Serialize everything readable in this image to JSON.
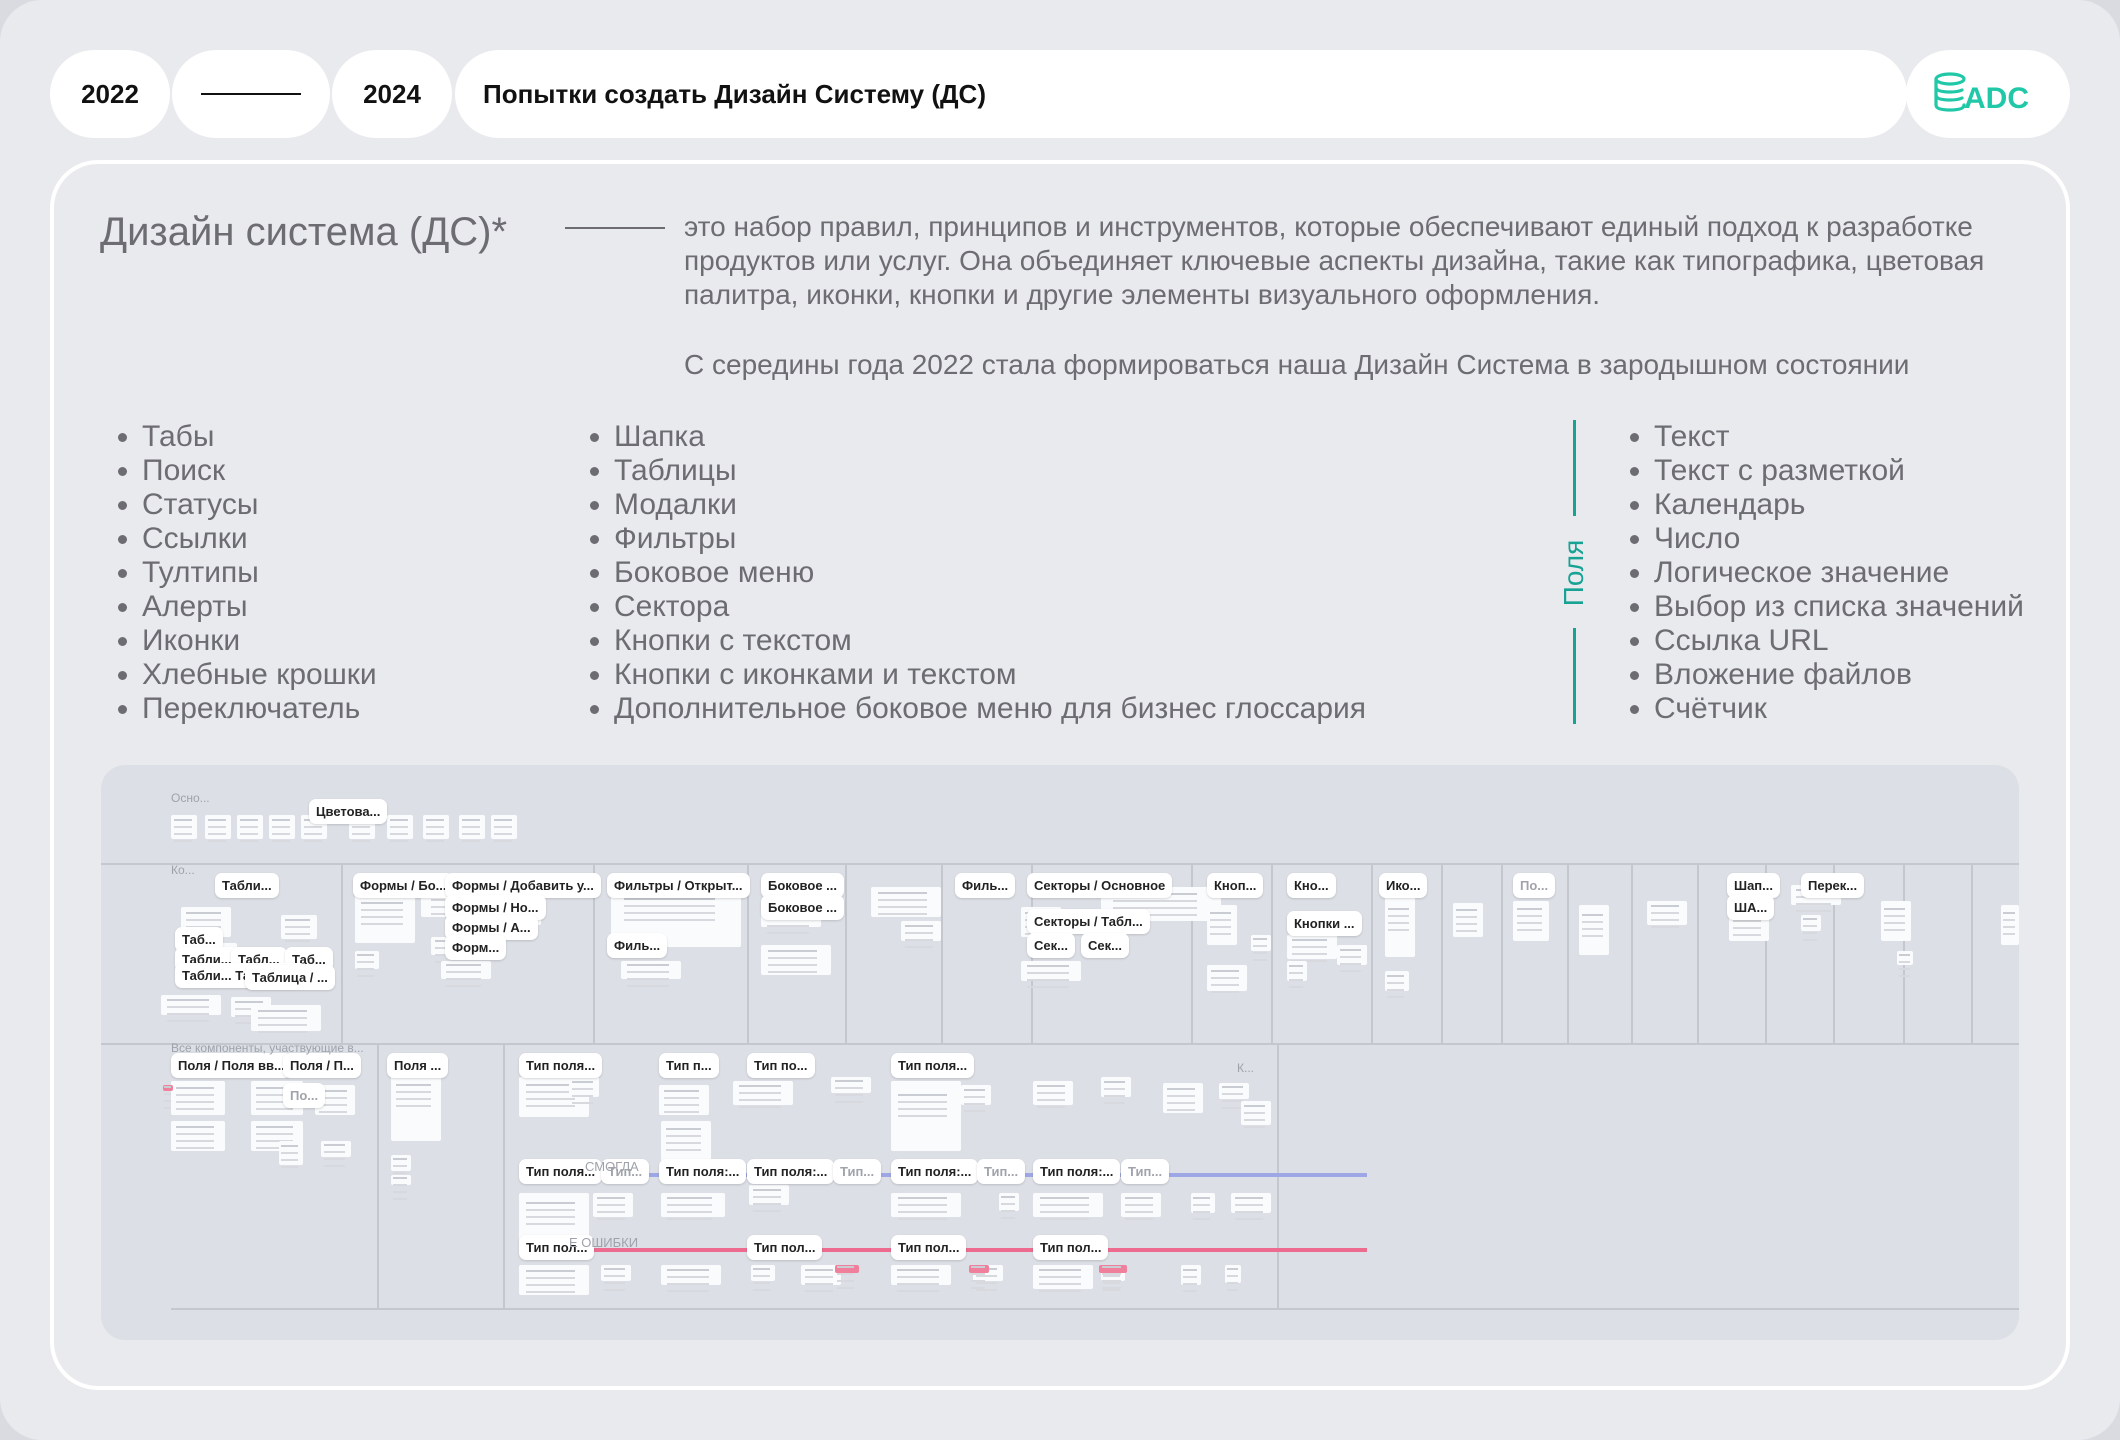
{
  "header": {
    "year_start": "2022",
    "year_end": "2024",
    "title": "Попытки создать Дизайн Систему (ДС)",
    "logo_text": "ADC"
  },
  "definition": {
    "term": "Дизайн система (ДС)*",
    "text": "это набор правил, принципов и инструментов, которые обеспечивают единый подход к разработке продуктов или услуг. Она объединяет ключевые аспекты дизайна, такие как типографика, цветовая палитра, иконки, кнопки и другие элементы визуального оформления.",
    "note": "С середины года 2022 стала формироваться наша Дизайн Система в зародышном состоянии"
  },
  "lists": {
    "col1": [
      "Табы",
      "Поиск",
      "Статусы",
      "Ссылки",
      "Тултипы",
      "Алерты",
      "Иконки",
      "Хлебные крошки",
      "Переключатель"
    ],
    "col2": [
      "Шапка",
      "Таблицы",
      "Модалки",
      "Фильтры",
      "Боковое меню",
      "Сектора",
      "Кнопки с текстом",
      "Кнопки с иконками и текстом",
      "Дополнительное боковое меню для бизнес глоссария"
    ],
    "fields_label": "Поля",
    "col3": [
      "Текст",
      "Текст с разметкой",
      "Календарь",
      "Число",
      "Логическое значение",
      "Выбор из списка значений",
      "Ссылка URL",
      "Вложение файлов",
      "Счётчик"
    ]
  },
  "canvas": {
    "labels": [
      "Цветова...",
      "Табли...",
      "Таб...",
      "Табли...",
      "Табл...",
      "Таб...",
      "Табли... Таблица...",
      "Таблица / ...",
      "Формы / Бо...",
      "Формы / Добавить у...",
      "Формы / Но...",
      "Формы / А...",
      "Форм...",
      "Фильтры / Открыт...",
      "Филь...",
      "Боковое ...",
      "Боковое ...",
      "Филь...",
      "Секторы / Основное",
      "Секторы / Табл...",
      "Сек...",
      "Сек...",
      "Кноп...",
      "Кно...",
      "Кнопки ...",
      "Ико...",
      "По...",
      "Шап...",
      "ША...",
      "Перек...",
      "Поля / Поля вв...",
      "Поля / П...",
      "По...",
      "Поля ...",
      "Тип поля...",
      "Тип п...",
      "Тип по...",
      "Тип поля...",
      "Тип поля...",
      "Тип...",
      "Тип поля:...",
      "Тип поля:...",
      "Тип...",
      "Тип поля:...",
      "Тип...",
      "Тип поля:...",
      "Тип...",
      "Тип пол...",
      "Тип пол...",
      "Тип пол...",
      "Тип пол..."
    ],
    "faint_labels": [
      "Осно...",
      "Ко...",
      "Все компоненты, участвующие в...",
      "К...",
      "СМОГЛА",
      "Е ОШИБКИ"
    ]
  },
  "colors": {
    "accent": "#16a394",
    "text_muted": "#6c6c72",
    "background": "#e9eaee",
    "canvas": "#dcdfe6",
    "band_blue": "#9ea7e6",
    "band_pink": "#ec6b8f"
  }
}
